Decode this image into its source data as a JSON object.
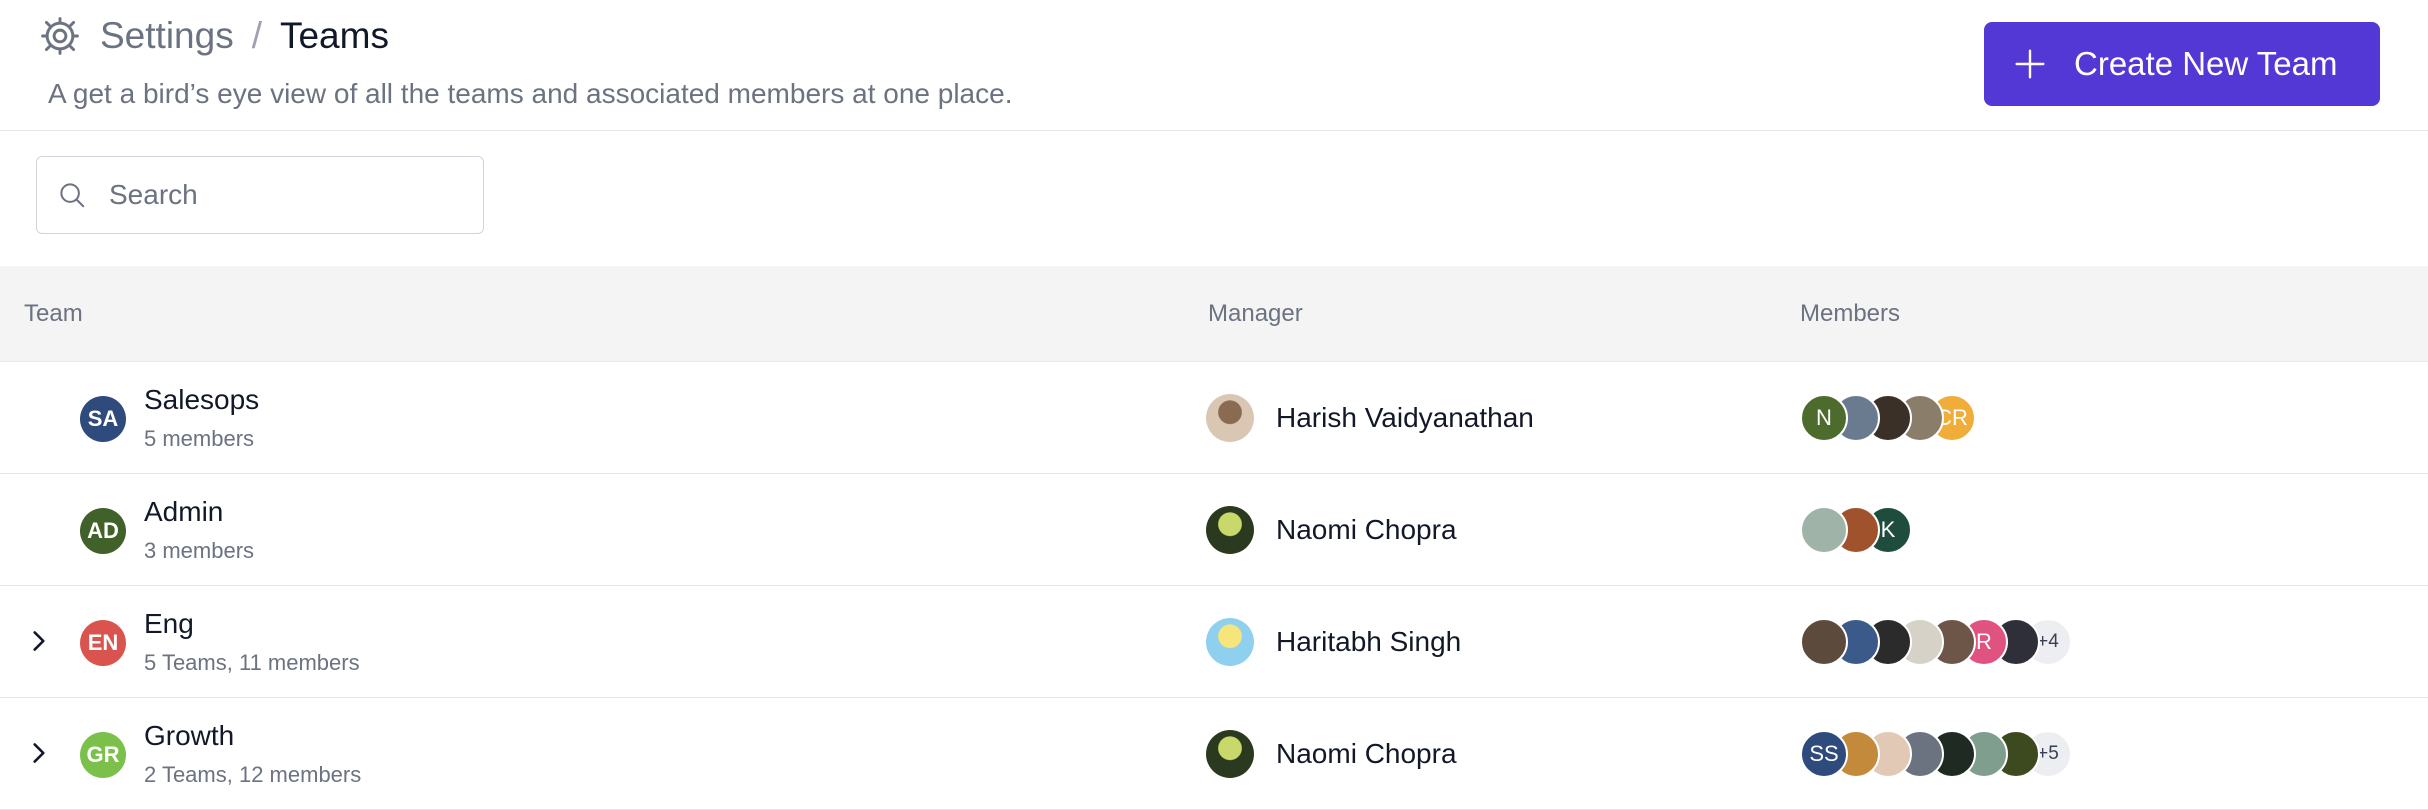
{
  "header": {
    "breadcrumb_root": "Settings",
    "breadcrumb_sep": "/",
    "breadcrumb_current": "Teams",
    "subtitle": "A get a bird’s eye view of all the teams and associated members at one place.",
    "create_button_label": "Create New Team"
  },
  "search": {
    "placeholder": "Search",
    "value": ""
  },
  "table": {
    "columns": {
      "team": "Team",
      "manager": "Manager",
      "members": "Members"
    },
    "rows": [
      {
        "team_initials": "SA",
        "team_color": "#2f4a7c",
        "team_name": "Salesops",
        "team_sub": "5 members",
        "expandable": false,
        "manager_name": "Harish Vaidyanathan",
        "manager_photo_colors": [
          "#d9c7b4",
          "#8a6a50"
        ],
        "members": [
          {
            "label": "N",
            "color": "#4d6b2c"
          },
          {
            "label": "",
            "color": "#6b7b8f"
          },
          {
            "label": "",
            "color": "#3a3028"
          },
          {
            "label": "",
            "color": "#8a7e6a"
          },
          {
            "label": "CR",
            "color": "#f0ad3a"
          }
        ]
      },
      {
        "team_initials": "AD",
        "team_color": "#40612a",
        "team_name": "Admin",
        "team_sub": "3 members",
        "expandable": false,
        "manager_name": "Naomi Chopra",
        "manager_photo_colors": [
          "#2b3a1f",
          "#c9d86a"
        ],
        "members": [
          {
            "label": "",
            "color": "#9fb3a8"
          },
          {
            "label": "",
            "color": "#a0522d"
          },
          {
            "label": "K",
            "color": "#1e4d3e"
          }
        ]
      },
      {
        "team_initials": "EN",
        "team_color": "#d9544f",
        "team_name": "Eng",
        "team_sub": "5 Teams, 11 members",
        "expandable": true,
        "manager_name": "Haritabh Singh",
        "manager_photo_colors": [
          "#8fd0ef",
          "#f6e57a"
        ],
        "members": [
          {
            "label": "",
            "color": "#5c4a3c"
          },
          {
            "label": "",
            "color": "#3b5a8a"
          },
          {
            "label": "",
            "color": "#2b2b2b"
          },
          {
            "label": "",
            "color": "#d7d2c8"
          },
          {
            "label": "",
            "color": "#6d5648"
          },
          {
            "label": "R",
            "color": "#e0527f"
          },
          {
            "label": "",
            "color": "#2f2f3a"
          },
          {
            "label": "+4",
            "color": "more"
          }
        ]
      },
      {
        "team_initials": "GR",
        "team_color": "#7bc04a",
        "team_name": "Growth",
        "team_sub": "2 Teams, 12 members",
        "expandable": true,
        "manager_name": "Naomi Chopra",
        "manager_photo_colors": [
          "#2b3a1f",
          "#c9d86a"
        ],
        "members": [
          {
            "label": "SS",
            "color": "#2f4a7c"
          },
          {
            "label": "",
            "color": "#c28a3a"
          },
          {
            "label": "",
            "color": "#e1c9b5"
          },
          {
            "label": "",
            "color": "#6b7280"
          },
          {
            "label": "",
            "color": "#1f2a22"
          },
          {
            "label": "",
            "color": "#7f9e8e"
          },
          {
            "label": "",
            "color": "#3d4a20"
          },
          {
            "label": "+5",
            "color": "more"
          }
        ]
      }
    ]
  }
}
